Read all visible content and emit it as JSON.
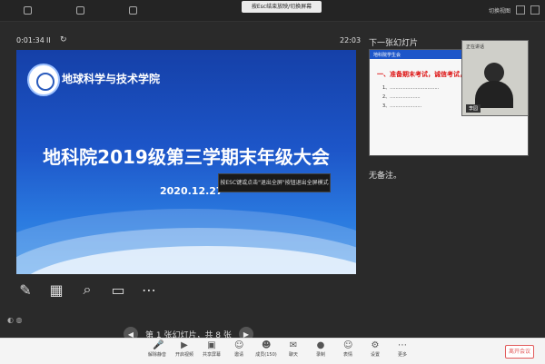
{
  "topbar": {
    "items": [
      "",
      "",
      ""
    ],
    "hint": "按Esc结束放映/切换屏幕",
    "right_label": "切换视图"
  },
  "presenter": {
    "timer": "0:01:34",
    "pause": "II",
    "reset": "↻",
    "clock": "22:03"
  },
  "slide": {
    "school": "地球科学与技术学院",
    "title": "地科院2019级第三学期末年级大会",
    "date": "2020.12.27",
    "tooltip": "按ESC键或点击\"退出全屏\"按钮退出全屏模式"
  },
  "tools": [
    {
      "name": "pen-icon",
      "glyph": "✎"
    },
    {
      "name": "grid-icon",
      "glyph": "▦"
    },
    {
      "name": "magnifier-icon",
      "glyph": "⌕"
    },
    {
      "name": "screen-icon",
      "glyph": "▭"
    },
    {
      "name": "more-icon",
      "glyph": "⋯"
    }
  ],
  "pager": {
    "prev": "◀",
    "text": "第 1 张幻灯片，共 8 张",
    "next": "▶"
  },
  "next_slide": {
    "label": "下一张幻灯片",
    "header": "地科院学生会",
    "heading": "一、准备期末考试，诚信考试，从我",
    "lines": [
      "1、..................................",
      "2、.....................",
      "3、......................"
    ]
  },
  "video": {
    "top_label": "正在讲话",
    "name": "李园"
  },
  "notes": "无备注。",
  "bottombar": {
    "buttons": [
      {
        "label": "解除静音",
        "glyph": "🎤"
      },
      {
        "label": "开启视频",
        "glyph": "▶"
      },
      {
        "label": "共享屏幕",
        "glyph": "▣"
      },
      {
        "label": "邀请",
        "glyph": "☺"
      },
      {
        "label": "成员(150)",
        "glyph": "☻"
      },
      {
        "label": "聊天",
        "glyph": "✉"
      },
      {
        "label": "录制",
        "glyph": "●"
      },
      {
        "label": "表情",
        "glyph": "☺"
      },
      {
        "label": "设置",
        "glyph": "⚙"
      },
      {
        "label": "更多",
        "glyph": "⋯"
      }
    ],
    "end": "离开会议"
  }
}
